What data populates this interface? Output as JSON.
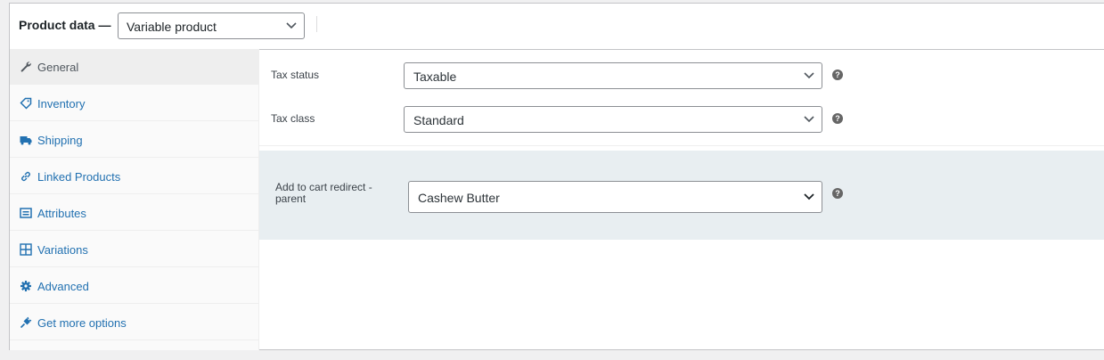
{
  "header": {
    "title": "Product data —",
    "product_type": "Variable product"
  },
  "tabs": [
    {
      "label": "General",
      "icon": "wrench-icon"
    },
    {
      "label": "Inventory",
      "icon": "tag-icon"
    },
    {
      "label": "Shipping",
      "icon": "truck-icon"
    },
    {
      "label": "Linked Products",
      "icon": "link-icon"
    },
    {
      "label": "Attributes",
      "icon": "list-icon"
    },
    {
      "label": "Variations",
      "icon": "grid-icon"
    },
    {
      "label": "Advanced",
      "icon": "gear-icon"
    },
    {
      "label": "Get more options",
      "icon": "plug-icon"
    }
  ],
  "active_tab": "General",
  "fields": {
    "tax_status": {
      "label": "Tax status",
      "value": "Taxable"
    },
    "tax_class": {
      "label": "Tax class",
      "value": "Standard"
    },
    "redirect": {
      "label_line1": "Add to cart redirect -",
      "label_line2": "parent",
      "value": "Cashew Butter"
    }
  },
  "help_glyph": "?",
  "colors": {
    "link": "#2271b1",
    "active_tab_bg": "#eeeeee",
    "redirect_band_bg": "#e8eef1",
    "help_bg": "#666666"
  }
}
